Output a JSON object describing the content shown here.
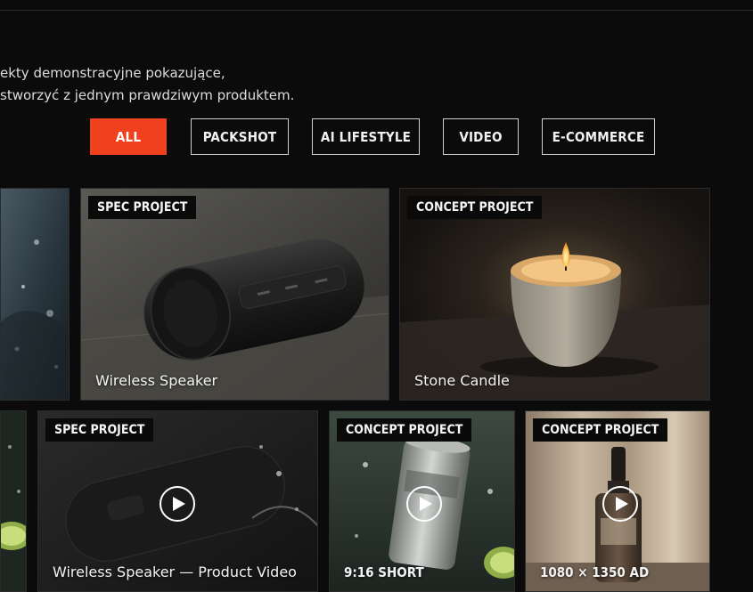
{
  "intro": {
    "line1": "ekty demonstracyjne pokazujące,",
    "line2": "stworzyć z jednym prawdziwym produktem."
  },
  "filters": [
    {
      "label": "ALL",
      "active": true
    },
    {
      "label": "PACKSHOT",
      "active": false
    },
    {
      "label": "AI LIFESTYLE",
      "active": false
    },
    {
      "label": "VIDEO",
      "active": false
    },
    {
      "label": "E-COMMERCE",
      "active": false
    }
  ],
  "cards": {
    "speaker": {
      "badge": "SPEC PROJECT",
      "caption": "Wireless Speaker"
    },
    "candle": {
      "badge": "CONCEPT PROJECT",
      "caption": "Stone Candle"
    },
    "speaker_video": {
      "badge": "SPEC PROJECT",
      "caption": "Wireless Speaker — Product Video"
    },
    "can_short": {
      "badge": "CONCEPT PROJECT",
      "caption": "9:16 SHORT"
    },
    "serum_ad": {
      "badge": "CONCEPT PROJECT",
      "caption": "1080 × 1350 AD"
    }
  },
  "colors": {
    "accent": "#f0411e",
    "background": "#0b0b0b"
  },
  "icons": [
    "play-icon"
  ]
}
